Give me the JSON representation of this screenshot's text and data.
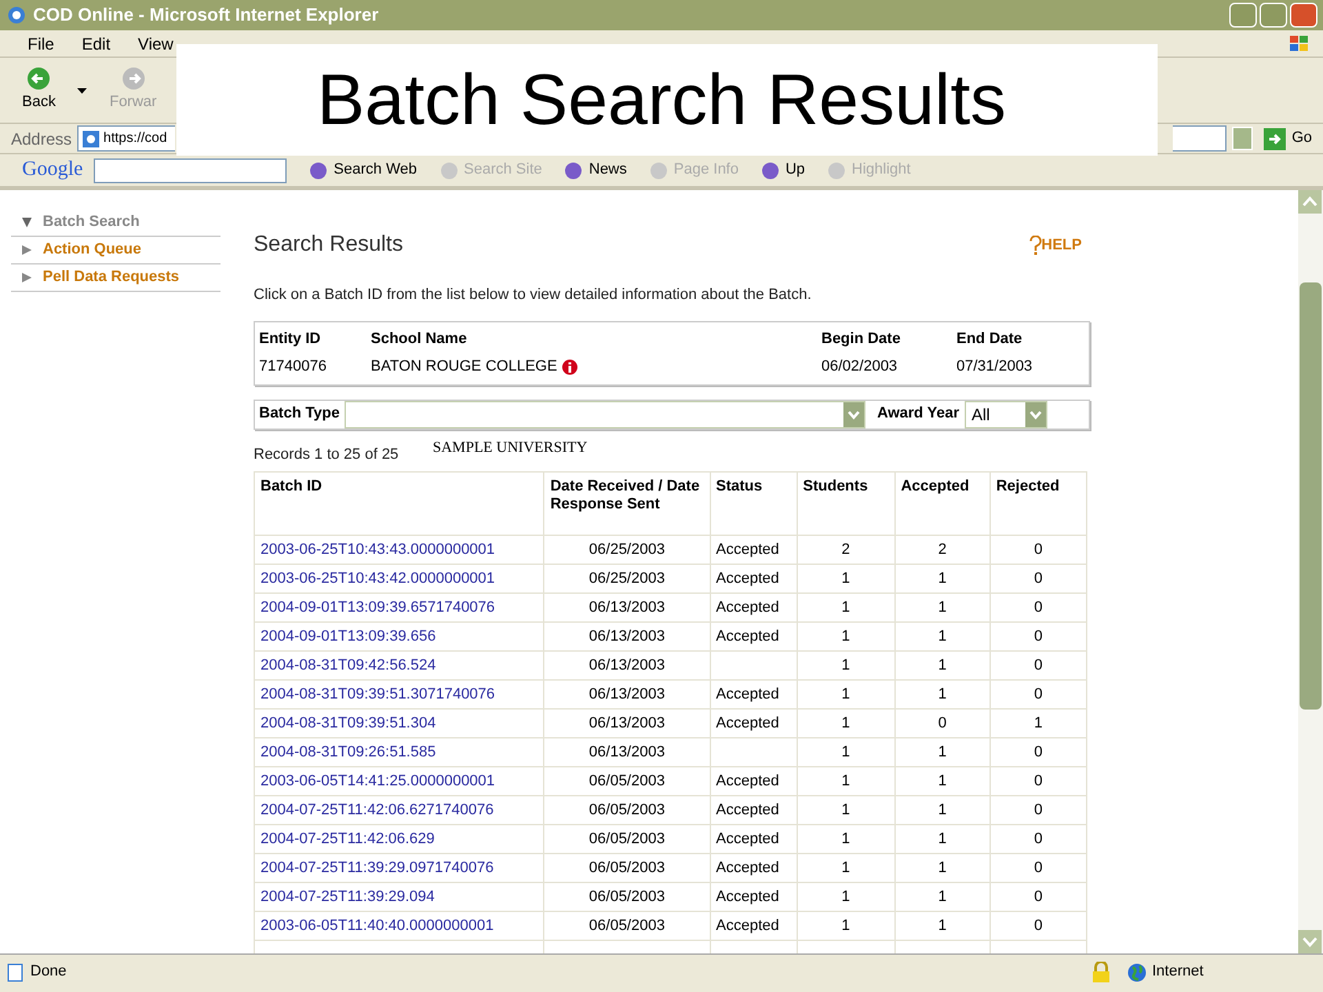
{
  "window": {
    "title": "COD Online - Microsoft Internet Explorer"
  },
  "menu": [
    "File",
    "Edit",
    "View"
  ],
  "toolbar": {
    "back": "Back",
    "forward": "Forwar"
  },
  "address": {
    "label": "Address",
    "value": "https://cod",
    "go": "Go"
  },
  "google_bar": [
    {
      "label": "Search Web",
      "disabled": false
    },
    {
      "label": "Search Site",
      "disabled": true
    },
    {
      "label": "News",
      "disabled": false
    },
    {
      "label": "Page Info",
      "disabled": true
    },
    {
      "label": "Up",
      "disabled": false
    },
    {
      "label": "Highlight",
      "disabled": true
    }
  ],
  "google_logo": "Google",
  "overlay_title": "Batch Search Results",
  "sidebar": {
    "items": [
      {
        "label": "Batch Search",
        "expanded": true
      },
      {
        "label": "Action Queue",
        "expanded": false
      },
      {
        "label": "Pell Data Requests",
        "expanded": false
      }
    ]
  },
  "page": {
    "heading": "Search Results",
    "help": "HELP",
    "instructions": "Click on a Batch ID from the list below to view detailed information about the Batch."
  },
  "entity": {
    "columns": [
      "Entity ID",
      "School Name",
      "Begin Date",
      "End Date"
    ],
    "values": [
      "71740076",
      "BATON ROUGE COLLEGE",
      "06/02/2003",
      "07/31/2003"
    ]
  },
  "filters": {
    "batch_type_label": "Batch Type",
    "award_year_label": "Award Year",
    "award_year_value": "All"
  },
  "overlay_caption": "SAMPLE UNIVERSITY",
  "records": "Records 1 to 25 of 25",
  "table": {
    "columns": [
      "Batch ID",
      "Date Received / Date Response Sent",
      "Status",
      "Students",
      "Accepted",
      "Rejected"
    ],
    "rows": [
      [
        "2003-06-25T10:43:43.0000000001",
        "06/25/2003",
        "Accepted",
        "2",
        "2",
        "0"
      ],
      [
        "2003-06-25T10:43:42.0000000001",
        "06/25/2003",
        "Accepted",
        "1",
        "1",
        "0"
      ],
      [
        "2004-09-01T13:09:39.6571740076",
        "06/13/2003",
        "Accepted",
        "1",
        "1",
        "0"
      ],
      [
        "2004-09-01T13:09:39.656",
        "06/13/2003",
        "Accepted",
        "1",
        "1",
        "0"
      ],
      [
        "2004-08-31T09:42:56.524",
        "06/13/2003",
        "",
        "1",
        "1",
        "0"
      ],
      [
        "2004-08-31T09:39:51.3071740076",
        "06/13/2003",
        "Accepted",
        "1",
        "1",
        "0"
      ],
      [
        "2004-08-31T09:39:51.304",
        "06/13/2003",
        "Accepted",
        "1",
        "0",
        "1"
      ],
      [
        "2004-08-31T09:26:51.585",
        "06/13/2003",
        "",
        "1",
        "1",
        "0"
      ],
      [
        "2003-06-05T14:41:25.0000000001",
        "06/05/2003",
        "Accepted",
        "1",
        "1",
        "0"
      ],
      [
        "2004-07-25T11:42:06.6271740076",
        "06/05/2003",
        "Accepted",
        "1",
        "1",
        "0"
      ],
      [
        "2004-07-25T11:42:06.629",
        "06/05/2003",
        "Accepted",
        "1",
        "1",
        "0"
      ],
      [
        "2004-07-25T11:39:29.0971740076",
        "06/05/2003",
        "Accepted",
        "1",
        "1",
        "0"
      ],
      [
        "2004-07-25T11:39:29.094",
        "06/05/2003",
        "Accepted",
        "1",
        "1",
        "0"
      ],
      [
        "2003-06-05T11:40:40.0000000001",
        "06/05/2003",
        "Accepted",
        "1",
        "1",
        "0"
      ]
    ]
  },
  "status_bar": {
    "text": "Done",
    "zone": "Internet"
  }
}
